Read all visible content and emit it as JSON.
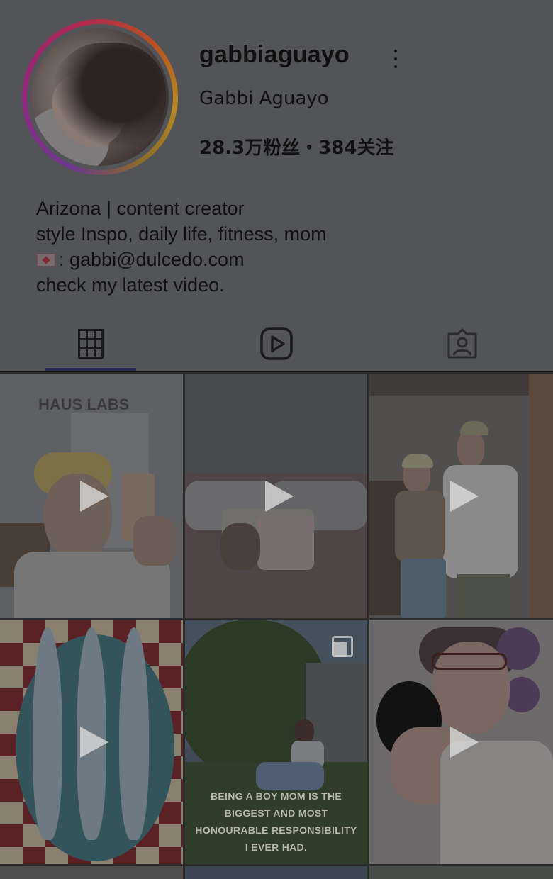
{
  "profile": {
    "username": "gabbiaguayo",
    "display_name": "Gabbi Aguayo",
    "stats": "28.3万粉丝・384关注",
    "bio_lines": [
      "Arizona | content creator",
      "style Inspo, daily life, fitness, mom",
      ": gabbi@dulcedo.com",
      "check my latest video."
    ]
  },
  "tabs": [
    {
      "icon": "grid-icon",
      "selected": true
    },
    {
      "icon": "reels-icon",
      "selected": false
    },
    {
      "icon": "tagged-icon",
      "selected": false
    }
  ],
  "posts": [
    {
      "type": "reel",
      "caption": "HAUS LABS"
    },
    {
      "type": "reel"
    },
    {
      "type": "reel"
    },
    {
      "type": "reel"
    },
    {
      "type": "carousel",
      "caption": "BEING A BOY MOM IS THE BIGGEST AND MOST HONOURABLE RESPONSIBILITY I EVER HAD."
    },
    {
      "type": "reel"
    }
  ],
  "colors": {
    "overlay_background": "#525458",
    "tab_indicator": "#262c57"
  }
}
